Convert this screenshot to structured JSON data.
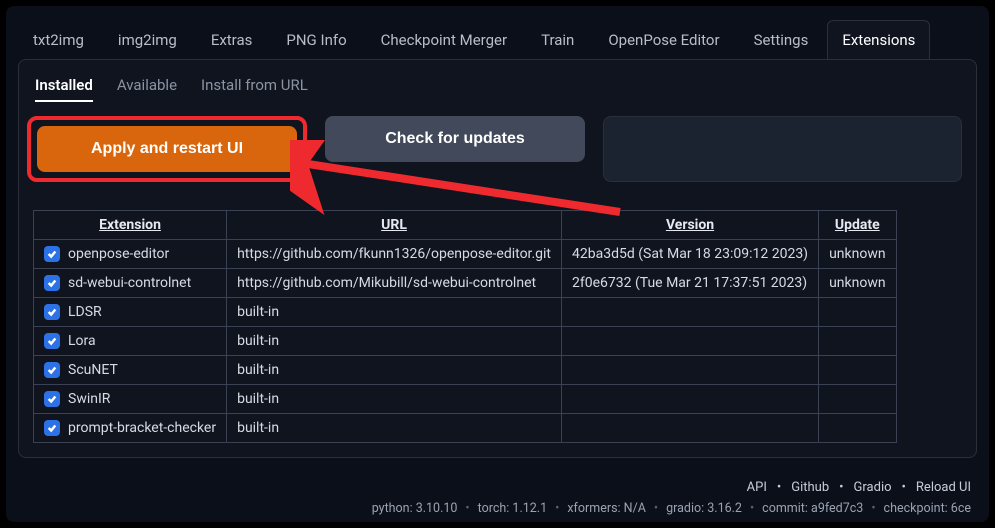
{
  "mainTabs": [
    {
      "label": "txt2img"
    },
    {
      "label": "img2img"
    },
    {
      "label": "Extras"
    },
    {
      "label": "PNG Info"
    },
    {
      "label": "Checkpoint Merger"
    },
    {
      "label": "Train"
    },
    {
      "label": "OpenPose Editor"
    },
    {
      "label": "Settings"
    },
    {
      "label": "Extensions",
      "active": true
    }
  ],
  "subTabs": [
    {
      "label": "Installed",
      "active": true
    },
    {
      "label": "Available"
    },
    {
      "label": "Install from URL"
    }
  ],
  "buttons": {
    "apply": "Apply and restart UI",
    "check": "Check for updates"
  },
  "table": {
    "headers": [
      "Extension",
      "URL",
      "Version",
      "Update"
    ],
    "rows": [
      {
        "checked": true,
        "name": "openpose-editor",
        "url": "https://github.com/fkunn1326/openpose-editor.git",
        "version": "42ba3d5d (Sat Mar 18 23:09:12 2023)",
        "update": "unknown"
      },
      {
        "checked": true,
        "name": "sd-webui-controlnet",
        "url": "https://github.com/Mikubill/sd-webui-controlnet",
        "version": "2f0e6732 (Tue Mar 21 17:37:51 2023)",
        "update": "unknown"
      },
      {
        "checked": true,
        "name": "LDSR",
        "url": "built-in",
        "version": "",
        "update": ""
      },
      {
        "checked": true,
        "name": "Lora",
        "url": "built-in",
        "version": "",
        "update": ""
      },
      {
        "checked": true,
        "name": "ScuNET",
        "url": "built-in",
        "version": "",
        "update": ""
      },
      {
        "checked": true,
        "name": "SwinIR",
        "url": "built-in",
        "version": "",
        "update": ""
      },
      {
        "checked": true,
        "name": "prompt-bracket-checker",
        "url": "built-in",
        "version": "",
        "update": ""
      }
    ]
  },
  "footer": {
    "links": [
      "API",
      "Github",
      "Gradio",
      "Reload UI"
    ],
    "meta": [
      "python: 3.10.10",
      "torch: 1.12.1",
      "xformers: N/A",
      "gradio: 3.16.2",
      "commit: a9fed7c3",
      "checkpoint: 6ce"
    ]
  }
}
